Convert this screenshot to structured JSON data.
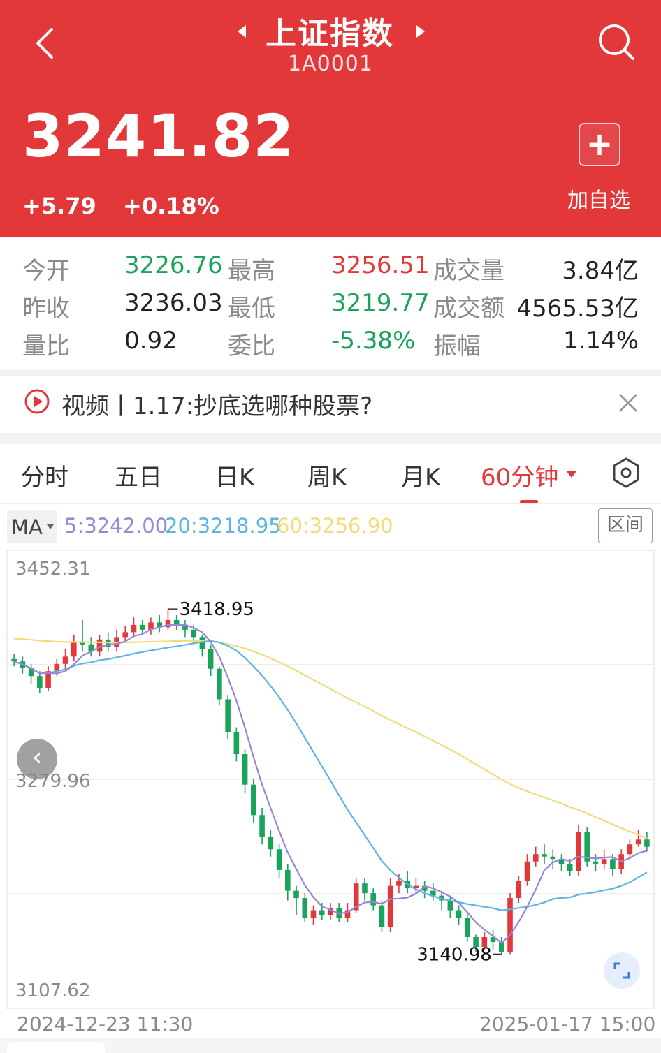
{
  "header": {
    "title": "上证指数",
    "code": "1A0001",
    "price": "3241.82",
    "change": "+5.79",
    "change_pct": "+0.18%",
    "add_label": "加自选",
    "bg_color": "#e2383a"
  },
  "quote": [
    {
      "label": "今开",
      "value": "3226.76",
      "tone": "green"
    },
    {
      "label": "最高",
      "value": "3256.51",
      "tone": "red"
    },
    {
      "label": "成交量",
      "value": "3.84亿",
      "tone": "dark"
    },
    {
      "label": "昨收",
      "value": "3236.03",
      "tone": "dark"
    },
    {
      "label": "最低",
      "value": "3219.77",
      "tone": "green"
    },
    {
      "label": "成交额",
      "value": "4565.53亿",
      "tone": "dark"
    },
    {
      "label": "量比",
      "value": "0.92",
      "tone": "dark"
    },
    {
      "label": "委比",
      "value": "-5.38%",
      "tone": "green"
    },
    {
      "label": "振幅",
      "value": "1.14%",
      "tone": "dark"
    }
  ],
  "news": {
    "text": "视频丨1.17:抄底选哪种股票?"
  },
  "tabs": [
    {
      "label": "分时",
      "active": false
    },
    {
      "label": "五日",
      "active": false
    },
    {
      "label": "日K",
      "active": false
    },
    {
      "label": "周K",
      "active": false
    },
    {
      "label": "月K",
      "active": false
    },
    {
      "label": "60分钟",
      "active": true
    }
  ],
  "ma_bar": {
    "label": "MA",
    "ma5": "5:3242.00",
    "ma20": "20:3218.95",
    "ma60": "60:3256.90",
    "range_label": "区间",
    "colors": {
      "ma5": "#9a86d6",
      "ma20": "#5bb6e2",
      "ma60": "#f2dc7a"
    }
  },
  "chart_data": {
    "type": "candlestick",
    "y_ticks": [
      "3452.31",
      "3279.96",
      "3107.62"
    ],
    "ylim": [
      3107.62,
      3452.31
    ],
    "x_range_labels": [
      "2024-12-23 11:30",
      "2025-01-17 15:00"
    ],
    "high_marker": "3418.95",
    "low_marker": "3140.98",
    "up_color": "#e2383a",
    "down_color": "#1aa35a",
    "candles": [
      [
        3378,
        3376,
        3382,
        3372
      ],
      [
        3376,
        3371,
        3380,
        3366
      ],
      [
        3371,
        3364,
        3374,
        3358
      ],
      [
        3364,
        3354,
        3368,
        3350
      ],
      [
        3354,
        3368,
        3372,
        3352
      ],
      [
        3368,
        3374,
        3378,
        3364
      ],
      [
        3374,
        3380,
        3386,
        3370
      ],
      [
        3380,
        3392,
        3398,
        3376
      ],
      [
        3392,
        3390,
        3410,
        3384
      ],
      [
        3390,
        3384,
        3396,
        3380
      ],
      [
        3384,
        3394,
        3398,
        3380
      ],
      [
        3394,
        3388,
        3400,
        3384
      ],
      [
        3388,
        3396,
        3402,
        3384
      ],
      [
        3396,
        3400,
        3405,
        3392
      ],
      [
        3400,
        3406,
        3412,
        3396
      ],
      [
        3406,
        3402,
        3410,
        3398
      ],
      [
        3402,
        3408,
        3412,
        3398
      ],
      [
        3408,
        3404,
        3414,
        3400
      ],
      [
        3404,
        3410,
        3419,
        3402
      ],
      [
        3410,
        3406,
        3414,
        3402
      ],
      [
        3406,
        3402,
        3410,
        3396
      ],
      [
        3402,
        3396,
        3406,
        3390
      ],
      [
        3396,
        3386,
        3398,
        3380
      ],
      [
        3386,
        3370,
        3390,
        3364
      ],
      [
        3370,
        3345,
        3372,
        3340
      ],
      [
        3345,
        3318,
        3348,
        3312
      ],
      [
        3318,
        3300,
        3322,
        3294
      ],
      [
        3300,
        3275,
        3304,
        3268
      ],
      [
        3275,
        3250,
        3280,
        3244
      ],
      [
        3250,
        3232,
        3256,
        3226
      ],
      [
        3232,
        3222,
        3238,
        3216
      ],
      [
        3222,
        3205,
        3226,
        3198
      ],
      [
        3205,
        3188,
        3210,
        3180
      ],
      [
        3188,
        3182,
        3192,
        3168
      ],
      [
        3182,
        3166,
        3186,
        3162
      ],
      [
        3166,
        3172,
        3176,
        3160
      ],
      [
        3172,
        3168,
        3178,
        3164
      ],
      [
        3168,
        3174,
        3178,
        3164
      ],
      [
        3174,
        3166,
        3178,
        3162
      ],
      [
        3166,
        3172,
        3178,
        3162
      ],
      [
        3172,
        3194,
        3198,
        3170
      ],
      [
        3194,
        3186,
        3198,
        3180
      ],
      [
        3186,
        3176,
        3190,
        3172
      ],
      [
        3176,
        3158,
        3180,
        3154
      ],
      [
        3158,
        3192,
        3198,
        3154
      ],
      [
        3192,
        3196,
        3202,
        3186
      ],
      [
        3196,
        3190,
        3204,
        3186
      ],
      [
        3190,
        3192,
        3198,
        3186
      ],
      [
        3192,
        3188,
        3196,
        3182
      ],
      [
        3188,
        3184,
        3194,
        3180
      ],
      [
        3184,
        3180,
        3188,
        3172
      ],
      [
        3180,
        3172,
        3184,
        3166
      ],
      [
        3172,
        3166,
        3176,
        3160
      ],
      [
        3166,
        3150,
        3170,
        3146
      ],
      [
        3150,
        3142,
        3152,
        3138
      ],
      [
        3142,
        3150,
        3154,
        3140
      ],
      [
        3150,
        3146,
        3156,
        3140
      ],
      [
        3146,
        3138,
        3150,
        3136
      ],
      [
        3138,
        3182,
        3186,
        3136
      ],
      [
        3182,
        3196,
        3200,
        3178
      ],
      [
        3196,
        3212,
        3218,
        3192
      ],
      [
        3212,
        3218,
        3224,
        3208
      ],
      [
        3218,
        3216,
        3226,
        3210
      ],
      [
        3216,
        3214,
        3222,
        3206
      ],
      [
        3214,
        3210,
        3218,
        3204
      ],
      [
        3210,
        3204,
        3214,
        3200
      ],
      [
        3204,
        3236,
        3242,
        3200
      ],
      [
        3236,
        3212,
        3240,
        3208
      ],
      [
        3212,
        3210,
        3218,
        3204
      ],
      [
        3210,
        3214,
        3222,
        3206
      ],
      [
        3214,
        3206,
        3218,
        3200
      ],
      [
        3206,
        3218,
        3222,
        3202
      ],
      [
        3218,
        3226,
        3230,
        3214
      ],
      [
        3226,
        3230,
        3238,
        3224
      ],
      [
        3230,
        3224,
        3236,
        3220
      ]
    ]
  }
}
